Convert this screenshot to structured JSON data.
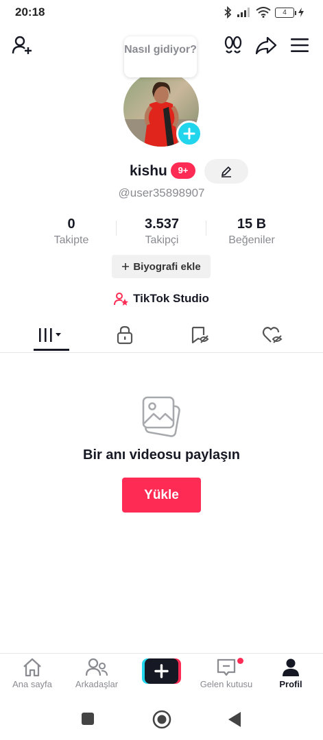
{
  "status_bar": {
    "time": "20:18",
    "battery": "4"
  },
  "header": {
    "add_friend_icon": "add-user-icon",
    "footprint_icon": "footprint-icon",
    "share_icon": "share-icon",
    "menu_icon": "menu-icon"
  },
  "profile": {
    "bubble_text": "Nasıl gidiyor?",
    "username": "kishu",
    "badge": "9+",
    "handle": "@user35898907"
  },
  "stats": [
    {
      "value": "0",
      "label": "Takipte"
    },
    {
      "value": "3.537",
      "label": "Takipçi"
    },
    {
      "value": "15 B",
      "label": "Beğeniler"
    }
  ],
  "bio_button": "Biyografi ekle",
  "studio_label": "TikTok Studio",
  "tabs": [
    {
      "name": "videos-grid",
      "icon": "grid-icon"
    },
    {
      "name": "private",
      "icon": "lock-icon"
    },
    {
      "name": "favorites",
      "icon": "bookmark-icon"
    },
    {
      "name": "liked",
      "icon": "heart-icon"
    }
  ],
  "empty_state": {
    "title": "Bir anı videosu paylaşın",
    "button": "Yükle"
  },
  "bottom_nav": [
    {
      "label": "Ana sayfa",
      "icon": "home-icon"
    },
    {
      "label": "Arkadaşlar",
      "icon": "friends-icon"
    },
    {
      "label": "",
      "icon": "plus-icon"
    },
    {
      "label": "Gelen kutusu",
      "icon": "inbox-icon"
    },
    {
      "label": "Profil",
      "icon": "profile-icon"
    }
  ],
  "colors": {
    "accent": "#fe2c55",
    "cyan": "#20d5ec",
    "text": "#161823",
    "muted": "#8a8b91"
  }
}
